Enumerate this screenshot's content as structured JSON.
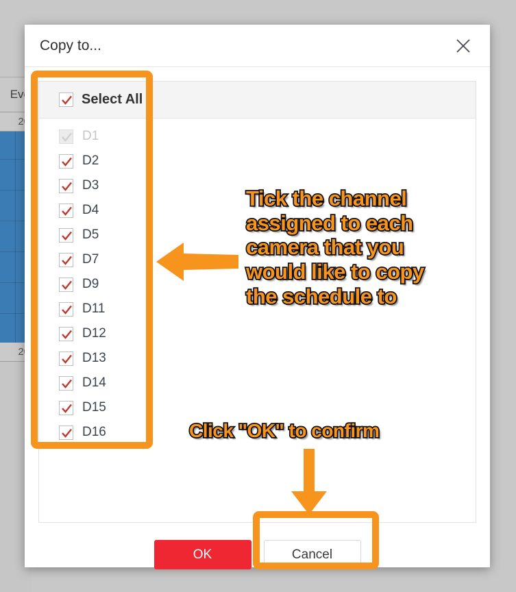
{
  "background": {
    "header_label": "Eve",
    "row_label_top": "20",
    "row_label_bottom": "20"
  },
  "dialog": {
    "title": "Copy to...",
    "close_icon": "close-icon",
    "select_all": {
      "label": "Select All",
      "checked": true
    },
    "channels": [
      {
        "label": "D1",
        "checked": true,
        "disabled": true
      },
      {
        "label": "D2",
        "checked": true,
        "disabled": false
      },
      {
        "label": "D3",
        "checked": true,
        "disabled": false
      },
      {
        "label": "D4",
        "checked": true,
        "disabled": false
      },
      {
        "label": "D5",
        "checked": true,
        "disabled": false
      },
      {
        "label": "D7",
        "checked": true,
        "disabled": false
      },
      {
        "label": "D9",
        "checked": true,
        "disabled": false
      },
      {
        "label": "D11",
        "checked": true,
        "disabled": false
      },
      {
        "label": "D12",
        "checked": true,
        "disabled": false
      },
      {
        "label": "D13",
        "checked": true,
        "disabled": false
      },
      {
        "label": "D14",
        "checked": true,
        "disabled": false
      },
      {
        "label": "D15",
        "checked": true,
        "disabled": false
      },
      {
        "label": "D16",
        "checked": true,
        "disabled": false
      }
    ],
    "footer": {
      "ok_label": "OK",
      "cancel_label": "Cancel"
    }
  },
  "annotations": {
    "tick_text": "Tick the channel\nassigned to each\ncamera that you\nwould like to copy\nthe schedule to",
    "ok_text": "Click \"OK\" to confirm",
    "arrow_left": "arrow-left-icon",
    "arrow_down": "arrow-down-icon"
  },
  "colors": {
    "accent_orange": "#F7941E",
    "ok_red": "#EF2733",
    "check_red": "#C0392B",
    "schedule_blue": "#3C7CB4"
  }
}
